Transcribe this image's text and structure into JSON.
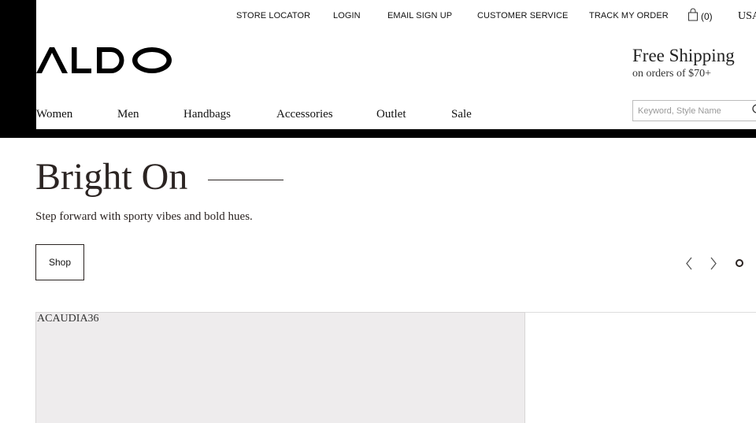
{
  "utility_nav": {
    "store_locator": "STORE LOCATOR",
    "login": "LOGIN",
    "email_signup": "EMAIL SIGN UP",
    "customer_service": "CUSTOMER SERVICE",
    "track_order": "TRACK MY ORDER",
    "cart_count": "(0)",
    "country": "USA"
  },
  "brand": {
    "logo_text": "ALDO"
  },
  "promo": {
    "title": "Free Shipping",
    "subtitle": "on orders of $70+"
  },
  "main_nav": {
    "items": [
      {
        "label": "Women"
      },
      {
        "label": "Men"
      },
      {
        "label": "Handbags"
      },
      {
        "label": "Accessories"
      },
      {
        "label": "Outlet"
      },
      {
        "label": "Sale"
      }
    ]
  },
  "search": {
    "placeholder": "Keyword, Style Name",
    "value": ""
  },
  "hero": {
    "title": "Bright On",
    "subtitle": "Step forward with sporty vibes and bold hues.",
    "cta_label": "Shop"
  },
  "carousel": {
    "slide_count": 1,
    "active_index": 0
  },
  "product": {
    "label": "ACAUDIA36"
  },
  "icons": {
    "cart": "shopping-bag-icon",
    "search": "search-icon",
    "prev": "chevron-left-icon",
    "next": "chevron-right-icon"
  },
  "colors": {
    "text_dark": "#2b2422",
    "black": "#000000",
    "tile_bg": "#eeeced"
  }
}
